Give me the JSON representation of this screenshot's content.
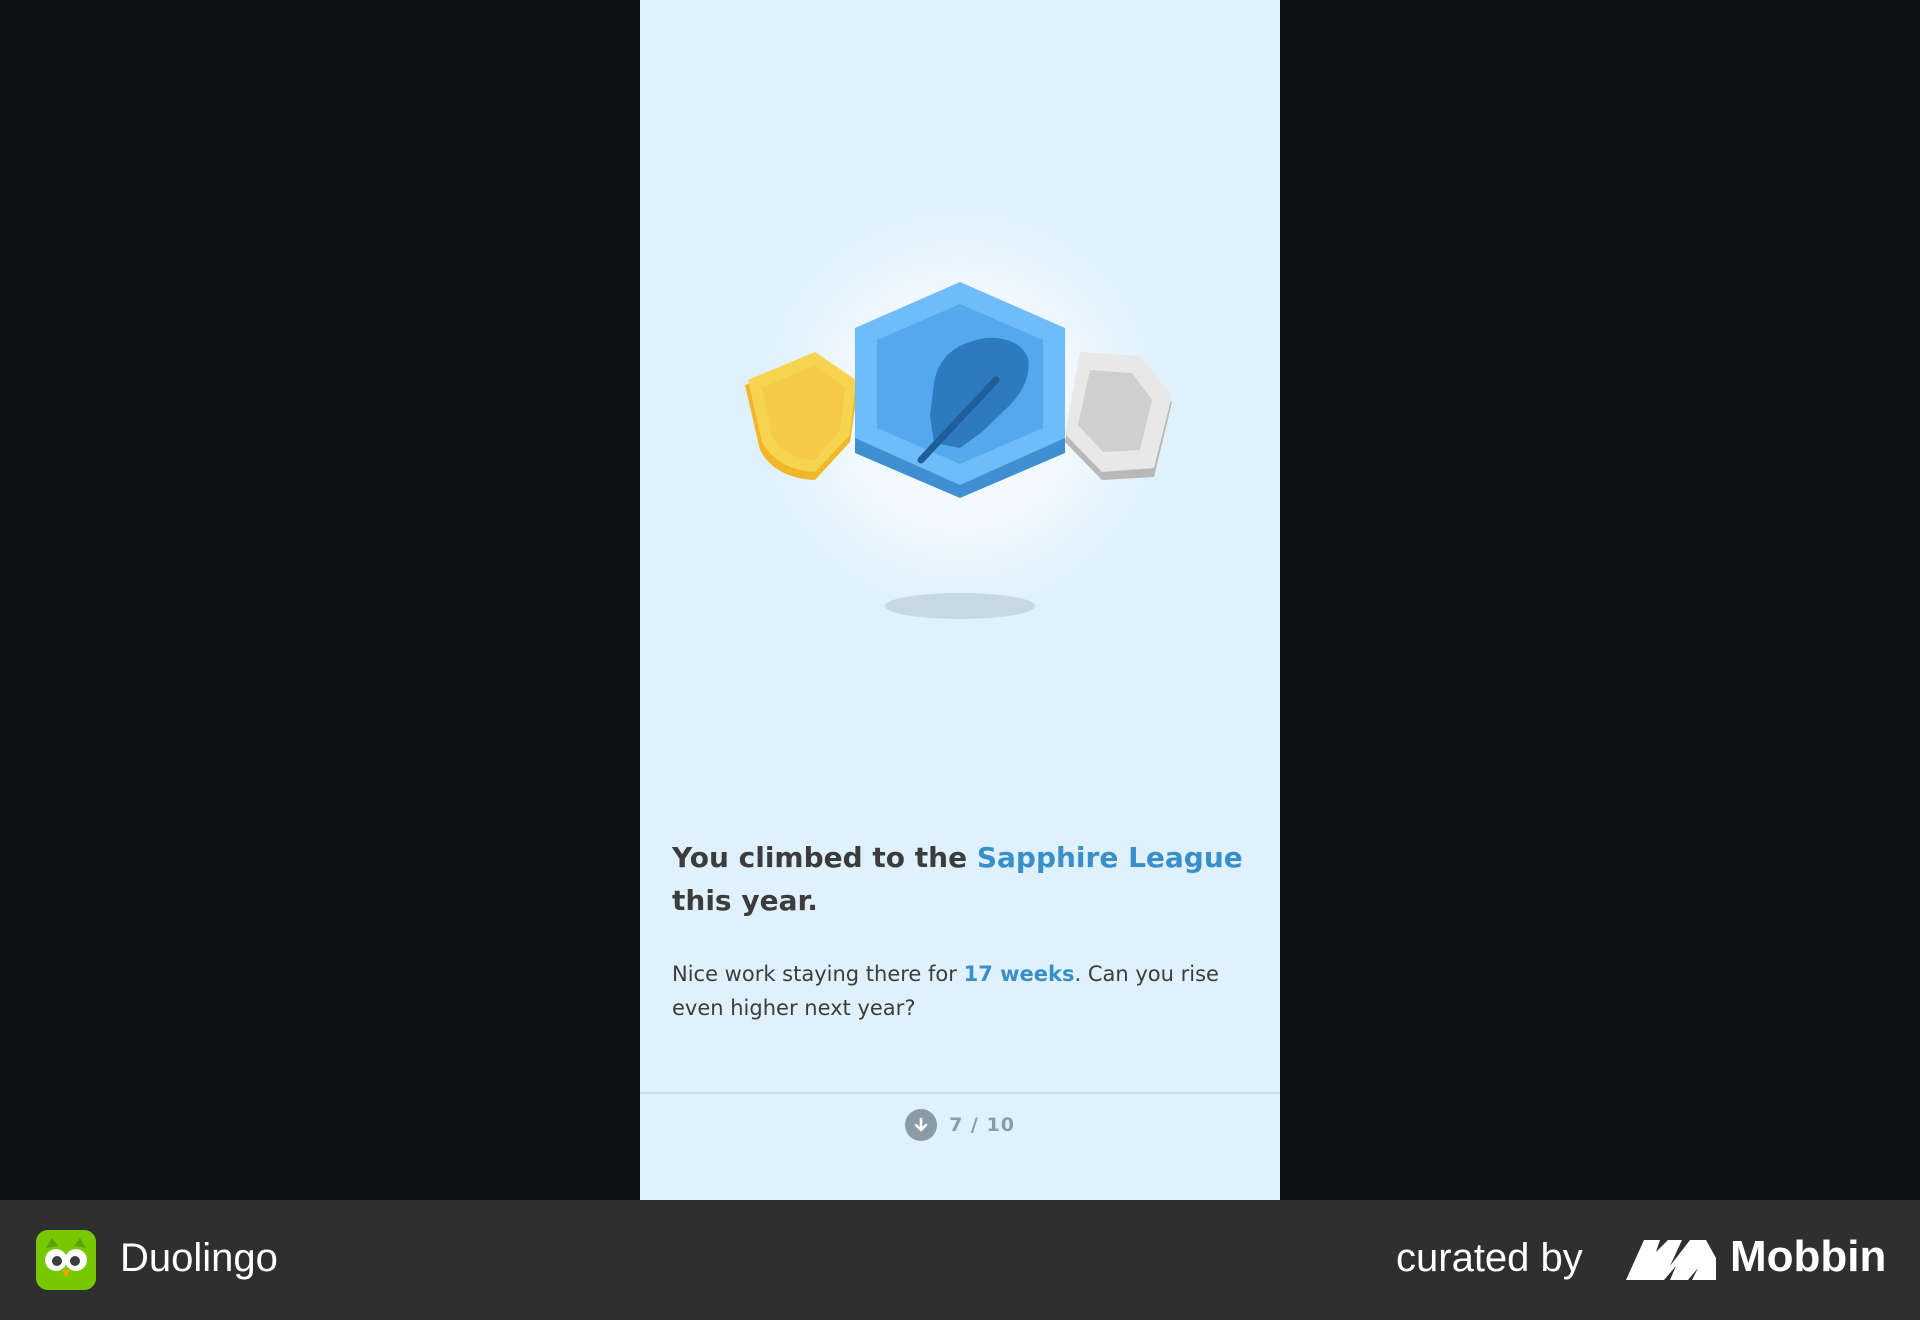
{
  "screen": {
    "headline": {
      "prefix": "You climbed to the ",
      "highlight": "Sapphire League",
      "suffix": " this year."
    },
    "subtext": {
      "prefix": "Nice work staying there for ",
      "highlight": "17 weeks",
      "suffix": ". Can you rise even higher next year?"
    },
    "pager": {
      "label": "7 / 10",
      "icon": "arrow-down-circle-icon"
    },
    "illustration": {
      "center_badge": "sapphire-feather-badge",
      "left_badge": "gold-shield-badge",
      "right_badge": "silver-hexagon-badge"
    }
  },
  "footer": {
    "app_name": "Duolingo",
    "app_icon": "duolingo-owl-icon",
    "curated_by": "curated by",
    "brand_name": "Mobbin",
    "brand_icon": "mobbin-logo-icon"
  },
  "colors": {
    "screen_background": "#e0f1fe",
    "accent": "#3a8fc9",
    "text": "#3c3c3c",
    "muted": "#8a9aa6",
    "sapphire": "#56a8ee",
    "gold": "#f7d44f",
    "silver": "#cfcfcf",
    "footer_background": "#2f2f2f"
  }
}
